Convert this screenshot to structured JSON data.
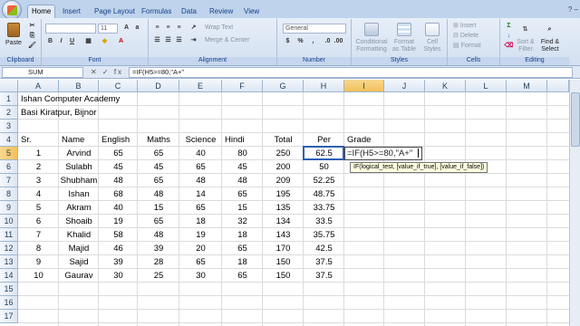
{
  "ribbon": {
    "tabs": [
      "Home",
      "Insert",
      "Page Layout",
      "Formulas",
      "Data",
      "Review",
      "View"
    ],
    "groups": {
      "clipboard": {
        "label": "Clipboard",
        "paste": "Paste"
      },
      "font": {
        "label": "Font",
        "font_size": "11"
      },
      "alignment": {
        "label": "Alignment",
        "wrap_text": "Wrap Text",
        "merge_center": "Merge & Center"
      },
      "number": {
        "label": "Number",
        "format": "General"
      },
      "styles": {
        "label": "Styles",
        "conditional": "Conditional",
        "conditional2": "Formatting",
        "format_as": "Format",
        "format_as2": "as Table",
        "cell": "Cell",
        "cell2": "Styles"
      },
      "cells": {
        "label": "Cells",
        "insert": "Insert",
        "delete": "Delete",
        "format": "Format"
      },
      "editing": {
        "label": "Editing",
        "sort": "Sort &",
        "sort2": "Filter",
        "find": "Find &",
        "find2": "Select"
      }
    }
  },
  "formula_bar": {
    "name_box": "SUM",
    "fx_icons": "✕ ✓ fx",
    "formula": "=IF(H5>=80,\"A+\""
  },
  "sheet": {
    "columns": [
      "A",
      "B",
      "C",
      "D",
      "E",
      "F",
      "G",
      "H",
      "I",
      "J",
      "K",
      "L",
      "M"
    ],
    "selected_column": "I",
    "rows": [
      "1",
      "2",
      "3",
      "4",
      "5",
      "6",
      "7",
      "8",
      "9",
      "10",
      "11",
      "12",
      "13",
      "14",
      "15",
      "16",
      "17"
    ],
    "selected_row": "5",
    "title1": "Ishan Computer Academy",
    "title2": "Basi Kiratpur, Bijnor",
    "headers": {
      "sr": "Sr.",
      "name": "Name",
      "english": "English",
      "maths": "Maths",
      "science": "Science",
      "hindi": "Hindi",
      "total": "Total",
      "per": "Per",
      "grade": "Grade"
    },
    "students": [
      {
        "sr": "1",
        "name": "Arvind",
        "english": "65",
        "maths": "65",
        "science": "40",
        "hindi": "80",
        "total": "250",
        "per": "62.5"
      },
      {
        "sr": "2",
        "name": "Sulabh",
        "english": "45",
        "maths": "45",
        "science": "65",
        "hindi": "45",
        "total": "200",
        "per": "50"
      },
      {
        "sr": "3",
        "name": "Shubham",
        "english": "48",
        "maths": "65",
        "science": "48",
        "hindi": "48",
        "total": "209",
        "per": "52.25"
      },
      {
        "sr": "4",
        "name": "Ishan",
        "english": "68",
        "maths": "48",
        "science": "14",
        "hindi": "65",
        "total": "195",
        "per": "48.75"
      },
      {
        "sr": "5",
        "name": "Akram",
        "english": "40",
        "maths": "15",
        "science": "65",
        "hindi": "15",
        "total": "135",
        "per": "33.75"
      },
      {
        "sr": "6",
        "name": "Shoaib",
        "english": "19",
        "maths": "65",
        "science": "18",
        "hindi": "32",
        "total": "134",
        "per": "33.5"
      },
      {
        "sr": "7",
        "name": "Khalid",
        "english": "58",
        "maths": "48",
        "science": "19",
        "hindi": "18",
        "total": "143",
        "per": "35.75"
      },
      {
        "sr": "8",
        "name": "Majid",
        "english": "46",
        "maths": "39",
        "science": "20",
        "hindi": "65",
        "total": "170",
        "per": "42.5"
      },
      {
        "sr": "9",
        "name": "Sajid",
        "english": "39",
        "maths": "28",
        "science": "65",
        "hindi": "18",
        "total": "150",
        "per": "37.5"
      },
      {
        "sr": "10",
        "name": "Gaurav",
        "english": "30",
        "maths": "25",
        "science": "30",
        "hindi": "65",
        "total": "150",
        "per": "37.5"
      }
    ],
    "editing_cell_text": "=IF(H5>=80,\"A+\"",
    "tooltip": "IF(logical_test, [value_if_true], [value_if_false])"
  }
}
